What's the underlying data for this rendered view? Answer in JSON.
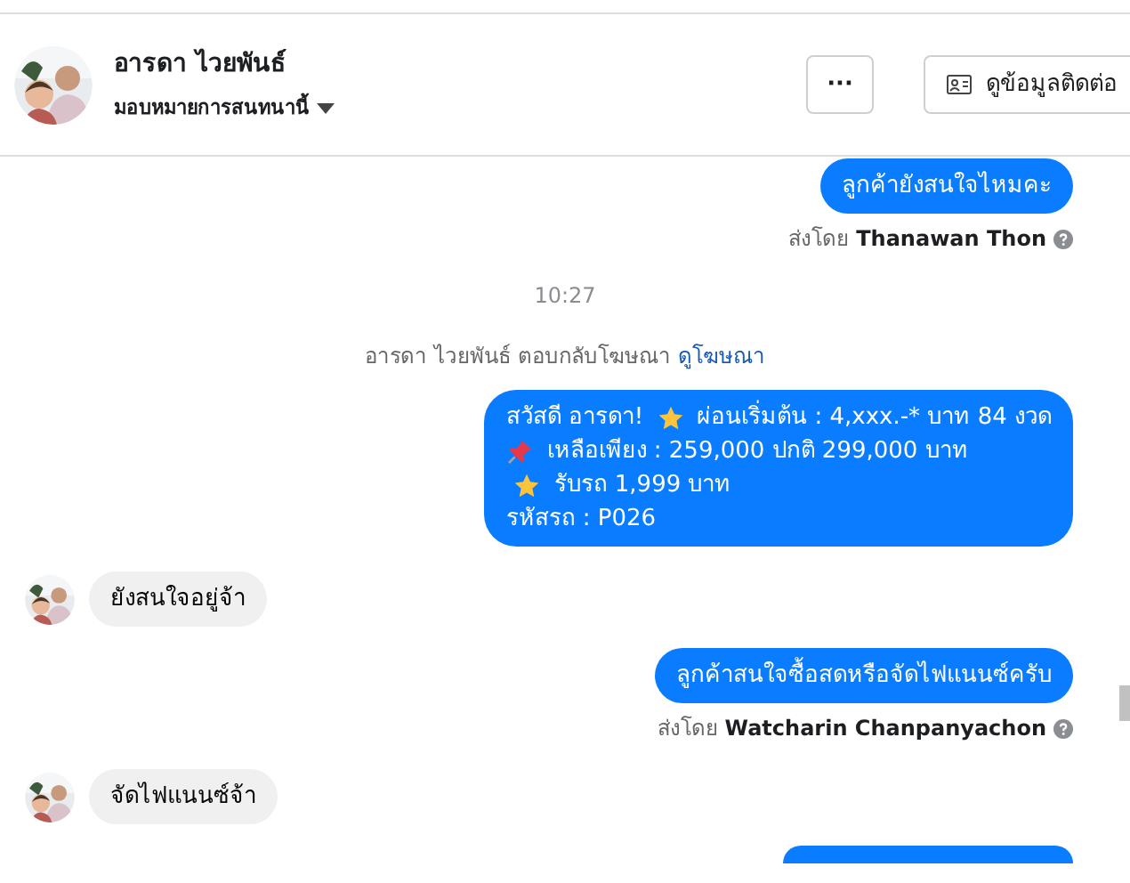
{
  "header": {
    "name": "อารดา ไวยพันธ์",
    "assign": "มอบหมายการสนทนานี้",
    "more_button": "···",
    "contact_button": "ดูข้อมูลติดต่อ"
  },
  "messages": [
    {
      "kind": "outgoing",
      "lines": [
        [
          {
            "kind": "text",
            "text": "ลูกค้ายังสนใจไหมคะ"
          }
        ]
      ],
      "sent_by_label": "ส่งโดย",
      "sender": "Thanawan Thon"
    },
    {
      "kind": "time",
      "text": "10:27"
    },
    {
      "kind": "system",
      "text": "อารดา ไวยพันธ์ ตอบกลับโฆษณา",
      "link": "ดูโฆษณา"
    },
    {
      "kind": "outgoing",
      "lines": [
        [
          {
            "kind": "text",
            "text": "สวัสดี อารดา!"
          },
          {
            "kind": "star"
          },
          {
            "kind": "text",
            "text": "ผ่อนเริ่มต้น : 4,xxx.-* บาท 84 งวด"
          }
        ],
        [
          {
            "kind": "pin"
          },
          {
            "kind": "text",
            "text": "เหลือเพียง : 259,000 ปกติ 299,000 บาท"
          }
        ],
        [
          {
            "kind": "star"
          },
          {
            "kind": "text",
            "text": "รับรถ 1,999 บาท"
          }
        ],
        [
          {
            "kind": "text",
            "text": "รหัสรถ : P026"
          }
        ]
      ]
    },
    {
      "kind": "incoming",
      "text": "ยังสนใจอยู่จ้า"
    },
    {
      "kind": "outgoing",
      "lines": [
        [
          {
            "kind": "text",
            "text": "ลูกค้าสนใจซื้อสดหรือจัดไฟแนนซ์ครับ"
          }
        ]
      ],
      "sent_by_label": "ส่งโดย",
      "sender": "Watcharin Chanpanyachon"
    },
    {
      "kind": "incoming",
      "text": "จัดไฟแนนซ์จ้า"
    },
    {
      "kind": "cut_bubble"
    }
  ]
}
